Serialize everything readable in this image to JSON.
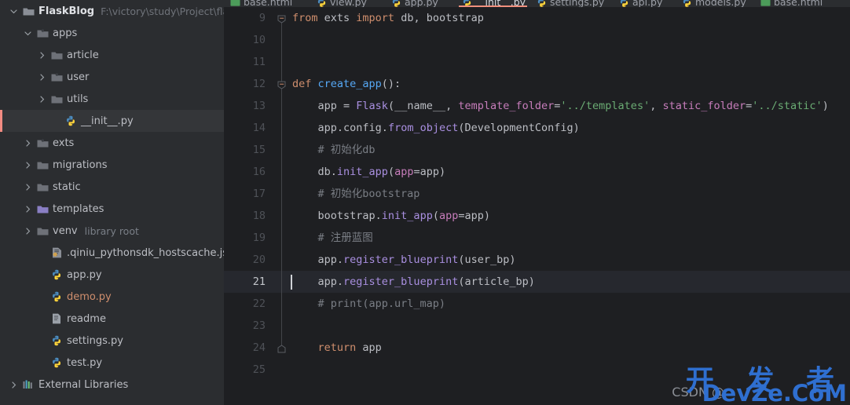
{
  "sidebar": {
    "items": [
      {
        "indent": 0,
        "arrow": "down",
        "icon": "folder-module-icon",
        "label": "FlaskBlog",
        "bold": true,
        "sub": "F:\\victory\\study\\Project\\flask\\Fl",
        "selected": false
      },
      {
        "indent": 1,
        "arrow": "down",
        "icon": "folder-source-icon",
        "label": "apps",
        "bold": false,
        "sub": "",
        "selected": false
      },
      {
        "indent": 2,
        "arrow": "right",
        "icon": "folder-icon",
        "label": "article",
        "bold": false,
        "sub": "",
        "selected": false
      },
      {
        "indent": 2,
        "arrow": "right",
        "icon": "folder-source-icon",
        "label": "user",
        "bold": false,
        "sub": "",
        "selected": false
      },
      {
        "indent": 2,
        "arrow": "right",
        "icon": "folder-icon",
        "label": "utils",
        "bold": false,
        "sub": "",
        "selected": false
      },
      {
        "indent": 3,
        "arrow": "none",
        "icon": "python-file-icon",
        "label": "__init__.py",
        "bold": false,
        "sub": "",
        "selected": true
      },
      {
        "indent": 1,
        "arrow": "right",
        "icon": "folder-source-icon",
        "label": "exts",
        "bold": false,
        "sub": "",
        "selected": false
      },
      {
        "indent": 1,
        "arrow": "right",
        "icon": "folder-icon",
        "label": "migrations",
        "bold": false,
        "sub": "",
        "selected": false
      },
      {
        "indent": 1,
        "arrow": "right",
        "icon": "folder-icon",
        "label": "static",
        "bold": false,
        "sub": "",
        "selected": false
      },
      {
        "indent": 1,
        "arrow": "right",
        "icon": "folder-template-icon",
        "label": "templates",
        "bold": false,
        "sub": "",
        "selected": false
      },
      {
        "indent": 1,
        "arrow": "right",
        "icon": "folder-icon",
        "label": "venv",
        "bold": false,
        "tag": "library root",
        "sub": "",
        "selected": false
      },
      {
        "indent": 2,
        "arrow": "none",
        "icon": "json-file-icon",
        "label": ".qiniu_pythonsdk_hostscache.json",
        "bold": false,
        "sub": "",
        "selected": false
      },
      {
        "indent": 2,
        "arrow": "none",
        "icon": "python-file-icon",
        "label": "app.py",
        "bold": false,
        "sub": "",
        "selected": false
      },
      {
        "indent": 2,
        "arrow": "none",
        "icon": "python-file-icon",
        "label": "demo.py",
        "bold": false,
        "orange": true,
        "sub": "",
        "selected": false
      },
      {
        "indent": 2,
        "arrow": "none",
        "icon": "text-file-icon",
        "label": "readme",
        "bold": false,
        "sub": "",
        "selected": false
      },
      {
        "indent": 2,
        "arrow": "none",
        "icon": "python-file-icon",
        "label": "settings.py",
        "bold": false,
        "sub": "",
        "selected": false
      },
      {
        "indent": 2,
        "arrow": "none",
        "icon": "python-file-icon",
        "label": "test.py",
        "bold": false,
        "sub": "",
        "selected": false
      },
      {
        "indent": 0,
        "arrow": "right",
        "icon": "external-libraries-icon",
        "label": "External Libraries",
        "bold": false,
        "sub": "",
        "selected": false
      }
    ]
  },
  "tabs": [
    {
      "label": "base.html",
      "icon": "html-file-icon",
      "active": false
    },
    {
      "label": "view.py",
      "icon": "python-file-icon",
      "active": false
    },
    {
      "label": "app.py",
      "icon": "python-file-icon",
      "active": false
    },
    {
      "label": "__init__.py",
      "icon": "python-file-icon",
      "active": true
    },
    {
      "label": "settings.py",
      "icon": "python-file-icon",
      "active": false
    },
    {
      "label": "api.py",
      "icon": "python-file-icon",
      "active": false
    },
    {
      "label": "models.py",
      "icon": "python-file-icon",
      "active": false
    },
    {
      "label": "base.html",
      "icon": "html-file-icon",
      "active": false
    }
  ],
  "editor": {
    "first_line_number": 9,
    "current_line_number": 21,
    "lines": [
      {
        "n": 9,
        "tokens": [
          {
            "t": "from ",
            "c": "kw"
          },
          {
            "t": "exts ",
            "c": "id"
          },
          {
            "t": "import ",
            "c": "kw"
          },
          {
            "t": "db, bootstrap",
            "c": "id"
          }
        ]
      },
      {
        "n": 10,
        "tokens": []
      },
      {
        "n": 11,
        "tokens": []
      },
      {
        "n": 12,
        "tokens": [
          {
            "t": "def ",
            "c": "kw"
          },
          {
            "t": "create_app",
            "c": "fn"
          },
          {
            "t": "():",
            "c": "id"
          }
        ]
      },
      {
        "n": 13,
        "tokens": [
          {
            "t": "    app ",
            "c": "id"
          },
          {
            "t": "= ",
            "c": "id"
          },
          {
            "t": "Flask",
            "c": "purple"
          },
          {
            "t": "(__name__, ",
            "c": "id"
          },
          {
            "t": "template_folder",
            "c": "param"
          },
          {
            "t": "=",
            "c": "id"
          },
          {
            "t": "'../templates'",
            "c": "str"
          },
          {
            "t": ", ",
            "c": "id"
          },
          {
            "t": "static_folder",
            "c": "param"
          },
          {
            "t": "=",
            "c": "id"
          },
          {
            "t": "'../static'",
            "c": "str"
          },
          {
            "t": ")",
            "c": "id"
          }
        ]
      },
      {
        "n": 14,
        "tokens": [
          {
            "t": "    app",
            "c": "id"
          },
          {
            "t": ".config.",
            "c": "id"
          },
          {
            "t": "from_object",
            "c": "purple"
          },
          {
            "t": "(DevelopmentConfig)",
            "c": "id"
          }
        ]
      },
      {
        "n": 15,
        "tokens": [
          {
            "t": "    # 初始化db",
            "c": "cmt"
          }
        ]
      },
      {
        "n": 16,
        "tokens": [
          {
            "t": "    db.",
            "c": "id"
          },
          {
            "t": "init_app",
            "c": "purple"
          },
          {
            "t": "(",
            "c": "id"
          },
          {
            "t": "app",
            "c": "param"
          },
          {
            "t": "=",
            "c": "id"
          },
          {
            "t": "app",
            "c": "id"
          },
          {
            "t": ")",
            "c": "id"
          }
        ]
      },
      {
        "n": 17,
        "tokens": [
          {
            "t": "    # 初始化bootstrap",
            "c": "cmt"
          }
        ]
      },
      {
        "n": 18,
        "tokens": [
          {
            "t": "    bootstrap.",
            "c": "id"
          },
          {
            "t": "init_app",
            "c": "purple"
          },
          {
            "t": "(",
            "c": "id"
          },
          {
            "t": "app",
            "c": "param"
          },
          {
            "t": "=",
            "c": "id"
          },
          {
            "t": "app",
            "c": "id"
          },
          {
            "t": ")",
            "c": "id"
          }
        ]
      },
      {
        "n": 19,
        "tokens": [
          {
            "t": "    # 注册蓝图",
            "c": "cmt"
          }
        ]
      },
      {
        "n": 20,
        "tokens": [
          {
            "t": "    app.",
            "c": "id"
          },
          {
            "t": "register_blueprint",
            "c": "purple"
          },
          {
            "t": "(user_bp)",
            "c": "id"
          }
        ]
      },
      {
        "n": 21,
        "tokens": [
          {
            "t": "    app.",
            "c": "id"
          },
          {
            "t": "register_blueprint",
            "c": "purple"
          },
          {
            "t": "(article_bp)",
            "c": "id"
          }
        ]
      },
      {
        "n": 22,
        "tokens": [
          {
            "t": "    # print(app.url_map)",
            "c": "cmt"
          }
        ]
      },
      {
        "n": 23,
        "tokens": []
      },
      {
        "n": 24,
        "tokens": [
          {
            "t": "    return ",
            "c": "kw"
          },
          {
            "t": "app",
            "c": "id"
          }
        ]
      },
      {
        "n": 25,
        "tokens": []
      }
    ]
  },
  "watermark": {
    "chinese": "开 发 者",
    "english": "DevZe.CoM",
    "csdn": "CSDN @"
  },
  "colors": {
    "accent_tab_underline": "#f08f7d",
    "selection_marker": "#f28b82",
    "editor_bg": "#1e1f22",
    "sidebar_bg": "#2b2d30",
    "current_line_bg": "#26282e",
    "watermark_blue": "#2f6fd0"
  }
}
